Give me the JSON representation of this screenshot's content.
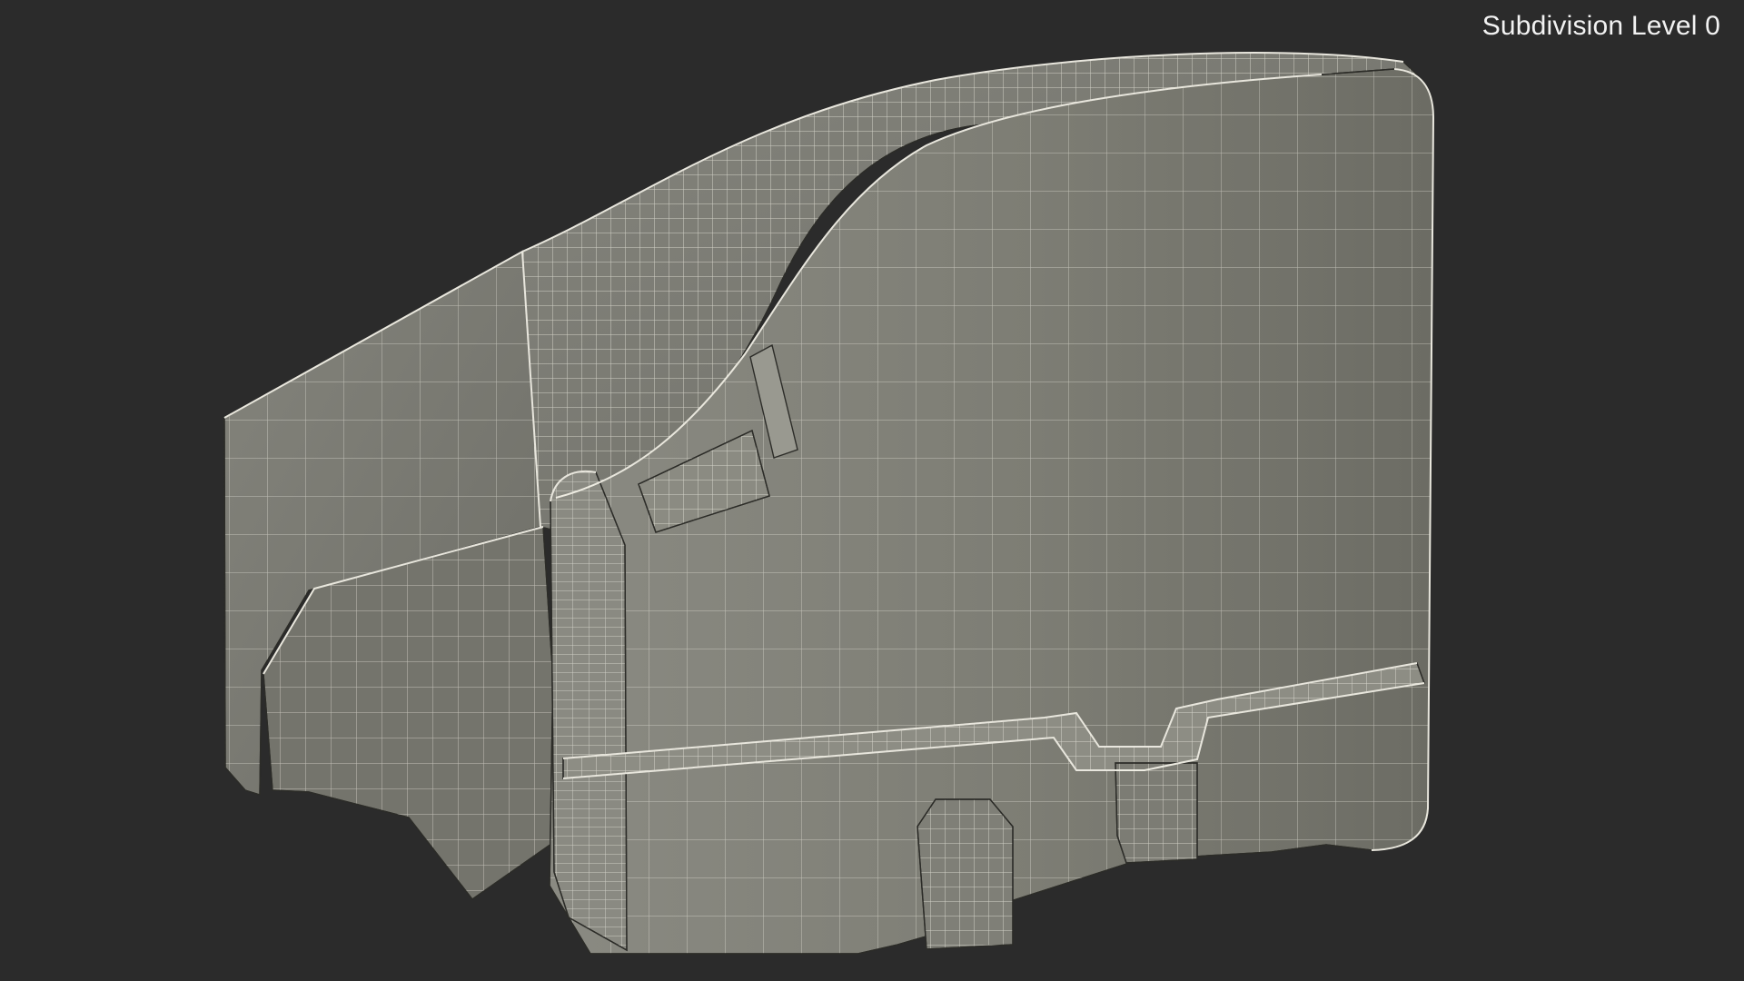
{
  "overlay": {
    "subdivision_label": "Subdivision Level 0"
  },
  "scene": {
    "background_color": "#2b2b2b",
    "mesh_fill_color": "#7a7a70",
    "wire_color": "#f3f1e7",
    "edge_color": "#2c2c28"
  }
}
